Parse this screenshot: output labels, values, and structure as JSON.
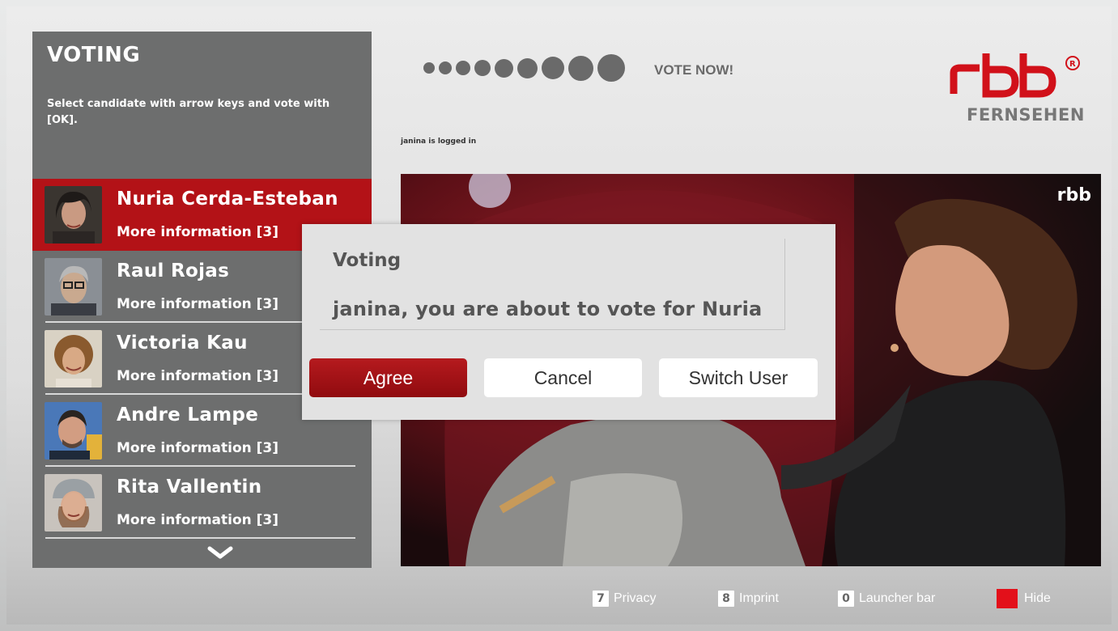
{
  "panel": {
    "title": "VOTING",
    "description": "Select candidate with arrow keys and vote with [OK].",
    "candidates": [
      {
        "name": "Nuria Cerda-Esteban",
        "more": "More information [3]",
        "selected": true
      },
      {
        "name": "Raul Rojas",
        "more": "More information [3]",
        "selected": false
      },
      {
        "name": "Victoria Kau",
        "more": "More information [3]",
        "selected": false
      },
      {
        "name": "Andre Lampe",
        "more": "More information [3]",
        "selected": false
      },
      {
        "name": "Rita Vallentin",
        "more": "More information [3]",
        "selected": false
      }
    ]
  },
  "progress": {
    "label": "VOTE NOW!",
    "step_count": 9
  },
  "status": {
    "logged_in": "janina is logged in"
  },
  "logo": {
    "brand": "rbb",
    "sub": "FERNSEHEN",
    "video_brand": "rbb"
  },
  "dialog": {
    "title": "Voting",
    "message": "janina, you are about to vote for Nuria",
    "agree": "Agree",
    "cancel": "Cancel",
    "switch_user": "Switch User"
  },
  "footer": {
    "items": [
      {
        "key": "7",
        "label": "Privacy"
      },
      {
        "key": "8",
        "label": "Imprint"
      },
      {
        "key": "0",
        "label": "Launcher bar"
      },
      {
        "key": "",
        "label": "Hide"
      }
    ]
  },
  "colors": {
    "accent_red": "#b31217",
    "panel_grey": "#6d6e6e",
    "hide_key_red": "#e3101a"
  }
}
